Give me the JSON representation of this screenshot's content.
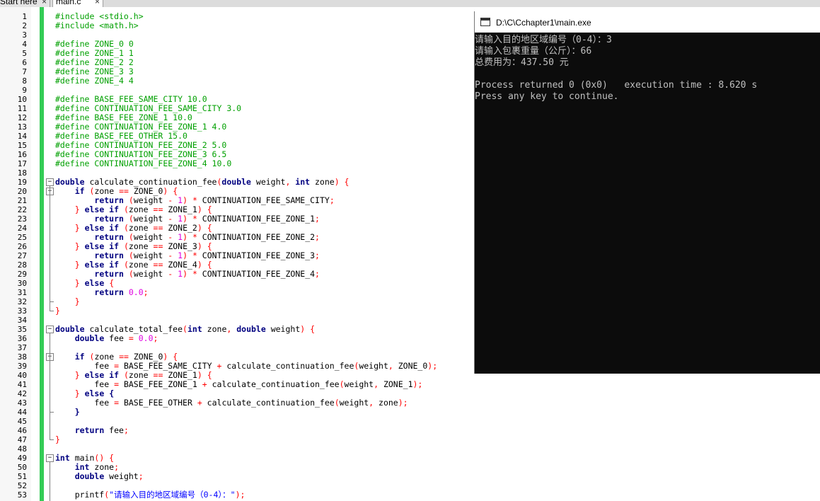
{
  "tabs": [
    {
      "label": "Start here",
      "close": "×"
    },
    {
      "label": "main.c",
      "close": "×"
    }
  ],
  "editor": {
    "lines": [
      {
        "n": "1",
        "t": [
          [
            "pp",
            "#include <stdio.h>"
          ]
        ]
      },
      {
        "n": "2",
        "t": [
          [
            "pp",
            "#include <math.h>"
          ]
        ]
      },
      {
        "n": "3",
        "t": []
      },
      {
        "n": "4",
        "t": [
          [
            "pp",
            "#define ZONE_0 0"
          ]
        ]
      },
      {
        "n": "5",
        "t": [
          [
            "pp",
            "#define ZONE_1 1"
          ]
        ]
      },
      {
        "n": "6",
        "t": [
          [
            "pp",
            "#define ZONE_2 2"
          ]
        ]
      },
      {
        "n": "7",
        "t": [
          [
            "pp",
            "#define ZONE_3 3"
          ]
        ]
      },
      {
        "n": "8",
        "t": [
          [
            "pp",
            "#define ZONE_4 4"
          ]
        ]
      },
      {
        "n": "9",
        "t": []
      },
      {
        "n": "10",
        "t": [
          [
            "pp",
            "#define BASE_FEE_SAME_CITY 10.0"
          ]
        ]
      },
      {
        "n": "11",
        "t": [
          [
            "pp",
            "#define CONTINUATION_FEE_SAME_CITY 3.0"
          ]
        ]
      },
      {
        "n": "12",
        "t": [
          [
            "pp",
            "#define BASE_FEE_ZONE_1 10.0"
          ]
        ]
      },
      {
        "n": "13",
        "t": [
          [
            "pp",
            "#define CONTINUATION_FEE_ZONE_1 4.0"
          ]
        ]
      },
      {
        "n": "14",
        "t": [
          [
            "pp",
            "#define BASE_FEE_OTHER 15.0"
          ]
        ]
      },
      {
        "n": "15",
        "t": [
          [
            "pp",
            "#define CONTINUATION_FEE_ZONE_2 5.0"
          ]
        ]
      },
      {
        "n": "16",
        "t": [
          [
            "pp",
            "#define CONTINUATION_FEE_ZONE_3 6.5"
          ]
        ]
      },
      {
        "n": "17",
        "t": [
          [
            "pp",
            "#define CONTINUATION_FEE_ZONE_4 10.0"
          ]
        ]
      },
      {
        "n": "18",
        "t": []
      },
      {
        "n": "19",
        "fold": "-",
        "t": [
          [
            "kw",
            "double"
          ],
          [
            "id",
            " calculate_continuation_fee"
          ],
          [
            "op",
            "("
          ],
          [
            "kw",
            "double"
          ],
          [
            "id",
            " weight"
          ],
          [
            "op",
            ", "
          ],
          [
            "kw",
            "int"
          ],
          [
            "id",
            " zone"
          ],
          [
            "op",
            ") {"
          ]
        ]
      },
      {
        "n": "20",
        "fold": "-",
        "t": [
          [
            "id",
            "    "
          ],
          [
            "kw",
            "if"
          ],
          [
            "id",
            " "
          ],
          [
            "op",
            "("
          ],
          [
            "id",
            "zone "
          ],
          [
            "op",
            "=="
          ],
          [
            "id",
            " ZONE_0"
          ],
          [
            "op",
            ") {"
          ]
        ]
      },
      {
        "n": "21",
        "t": [
          [
            "id",
            "        "
          ],
          [
            "kw",
            "return"
          ],
          [
            "id",
            " "
          ],
          [
            "op",
            "("
          ],
          [
            "id",
            "weight "
          ],
          [
            "op",
            "-"
          ],
          [
            "id",
            " "
          ],
          [
            "num",
            "1"
          ],
          [
            "op",
            ") *"
          ],
          [
            "id",
            " CONTINUATION_FEE_SAME_CITY"
          ],
          [
            "op",
            ";"
          ]
        ]
      },
      {
        "n": "22",
        "t": [
          [
            "id",
            "    "
          ],
          [
            "op",
            "} "
          ],
          [
            "kw",
            "else if"
          ],
          [
            "id",
            " "
          ],
          [
            "op",
            "("
          ],
          [
            "id",
            "zone "
          ],
          [
            "op",
            "=="
          ],
          [
            "id",
            " ZONE_1"
          ],
          [
            "op",
            ") {"
          ]
        ]
      },
      {
        "n": "23",
        "t": [
          [
            "id",
            "        "
          ],
          [
            "kw",
            "return"
          ],
          [
            "id",
            " "
          ],
          [
            "op",
            "("
          ],
          [
            "id",
            "weight "
          ],
          [
            "op",
            "-"
          ],
          [
            "id",
            " "
          ],
          [
            "num",
            "1"
          ],
          [
            "op",
            ") *"
          ],
          [
            "id",
            " CONTINUATION_FEE_ZONE_1"
          ],
          [
            "op",
            ";"
          ]
        ]
      },
      {
        "n": "24",
        "t": [
          [
            "id",
            "    "
          ],
          [
            "op",
            "} "
          ],
          [
            "kw",
            "else if"
          ],
          [
            "id",
            " "
          ],
          [
            "op",
            "("
          ],
          [
            "id",
            "zone "
          ],
          [
            "op",
            "=="
          ],
          [
            "id",
            " ZONE_2"
          ],
          [
            "op",
            ") {"
          ]
        ]
      },
      {
        "n": "25",
        "t": [
          [
            "id",
            "        "
          ],
          [
            "kw",
            "return"
          ],
          [
            "id",
            " "
          ],
          [
            "op",
            "("
          ],
          [
            "id",
            "weight "
          ],
          [
            "op",
            "-"
          ],
          [
            "id",
            " "
          ],
          [
            "num",
            "1"
          ],
          [
            "op",
            ") *"
          ],
          [
            "id",
            " CONTINUATION_FEE_ZONE_2"
          ],
          [
            "op",
            ";"
          ]
        ]
      },
      {
        "n": "26",
        "t": [
          [
            "id",
            "    "
          ],
          [
            "op",
            "} "
          ],
          [
            "kw",
            "else if"
          ],
          [
            "id",
            " "
          ],
          [
            "op",
            "("
          ],
          [
            "id",
            "zone "
          ],
          [
            "op",
            "=="
          ],
          [
            "id",
            " ZONE_3"
          ],
          [
            "op",
            ") {"
          ]
        ]
      },
      {
        "n": "27",
        "t": [
          [
            "id",
            "        "
          ],
          [
            "kw",
            "return"
          ],
          [
            "id",
            " "
          ],
          [
            "op",
            "("
          ],
          [
            "id",
            "weight "
          ],
          [
            "op",
            "-"
          ],
          [
            "id",
            " "
          ],
          [
            "num",
            "1"
          ],
          [
            "op",
            ") *"
          ],
          [
            "id",
            " CONTINUATION_FEE_ZONE_3"
          ],
          [
            "op",
            ";"
          ]
        ]
      },
      {
        "n": "28",
        "t": [
          [
            "id",
            "    "
          ],
          [
            "op",
            "} "
          ],
          [
            "kw",
            "else if"
          ],
          [
            "id",
            " "
          ],
          [
            "op",
            "("
          ],
          [
            "id",
            "zone "
          ],
          [
            "op",
            "=="
          ],
          [
            "id",
            " ZONE_4"
          ],
          [
            "op",
            ") {"
          ]
        ]
      },
      {
        "n": "29",
        "t": [
          [
            "id",
            "        "
          ],
          [
            "kw",
            "return"
          ],
          [
            "id",
            " "
          ],
          [
            "op",
            "("
          ],
          [
            "id",
            "weight "
          ],
          [
            "op",
            "-"
          ],
          [
            "id",
            " "
          ],
          [
            "num",
            "1"
          ],
          [
            "op",
            ") *"
          ],
          [
            "id",
            " CONTINUATION_FEE_ZONE_4"
          ],
          [
            "op",
            ";"
          ]
        ]
      },
      {
        "n": "30",
        "t": [
          [
            "id",
            "    "
          ],
          [
            "op",
            "} "
          ],
          [
            "kw",
            "else"
          ],
          [
            "op",
            " {"
          ]
        ]
      },
      {
        "n": "31",
        "t": [
          [
            "id",
            "        "
          ],
          [
            "kw",
            "return"
          ],
          [
            "id",
            " "
          ],
          [
            "num",
            "0.0"
          ],
          [
            "op",
            ";"
          ]
        ]
      },
      {
        "n": "32",
        "t": [
          [
            "id",
            "    "
          ],
          [
            "op",
            "}"
          ]
        ]
      },
      {
        "n": "33",
        "t": [
          [
            "op",
            "}"
          ]
        ]
      },
      {
        "n": "34",
        "t": []
      },
      {
        "n": "35",
        "fold": "-",
        "t": [
          [
            "kw",
            "double"
          ],
          [
            "id",
            " calculate_total_fee"
          ],
          [
            "op",
            "("
          ],
          [
            "kw",
            "int"
          ],
          [
            "id",
            " zone"
          ],
          [
            "op",
            ", "
          ],
          [
            "kw",
            "double"
          ],
          [
            "id",
            " weight"
          ],
          [
            "op",
            ") {"
          ]
        ]
      },
      {
        "n": "36",
        "t": [
          [
            "id",
            "    "
          ],
          [
            "kw",
            "double"
          ],
          [
            "id",
            " fee "
          ],
          [
            "op",
            "="
          ],
          [
            "id",
            " "
          ],
          [
            "num",
            "0.0"
          ],
          [
            "op",
            ";"
          ]
        ]
      },
      {
        "n": "37",
        "t": []
      },
      {
        "n": "38",
        "fold": "-",
        "t": [
          [
            "id",
            "    "
          ],
          [
            "kw",
            "if"
          ],
          [
            "id",
            " "
          ],
          [
            "op",
            "("
          ],
          [
            "id",
            "zone "
          ],
          [
            "op",
            "=="
          ],
          [
            "id",
            " ZONE_0"
          ],
          [
            "op",
            ") {"
          ]
        ]
      },
      {
        "n": "39",
        "t": [
          [
            "id",
            "        fee "
          ],
          [
            "op",
            "="
          ],
          [
            "id",
            " BASE_FEE_SAME_CITY "
          ],
          [
            "op",
            "+"
          ],
          [
            "id",
            " calculate_continuation_fee"
          ],
          [
            "op",
            "("
          ],
          [
            "id",
            "weight"
          ],
          [
            "op",
            ","
          ],
          [
            "id",
            " ZONE_0"
          ],
          [
            "op",
            ");"
          ]
        ]
      },
      {
        "n": "40",
        "t": [
          [
            "id",
            "    "
          ],
          [
            "op",
            "} "
          ],
          [
            "kw",
            "else if"
          ],
          [
            "id",
            " "
          ],
          [
            "op",
            "("
          ],
          [
            "id",
            "zone "
          ],
          [
            "op",
            "=="
          ],
          [
            "id",
            " ZONE_1"
          ],
          [
            "op",
            ") {"
          ]
        ]
      },
      {
        "n": "41",
        "t": [
          [
            "id",
            "        fee "
          ],
          [
            "op",
            "="
          ],
          [
            "id",
            " BASE_FEE_ZONE_1 "
          ],
          [
            "op",
            "+"
          ],
          [
            "id",
            " calculate_continuation_fee"
          ],
          [
            "op",
            "("
          ],
          [
            "id",
            "weight"
          ],
          [
            "op",
            ","
          ],
          [
            "id",
            " ZONE_1"
          ],
          [
            "op",
            ");"
          ]
        ]
      },
      {
        "n": "42",
        "t": [
          [
            "id",
            "    "
          ],
          [
            "op",
            "} "
          ],
          [
            "kw",
            "else"
          ],
          [
            "id",
            " "
          ],
          [
            "kw",
            "{"
          ]
        ]
      },
      {
        "n": "43",
        "t": [
          [
            "id",
            "        fee "
          ],
          [
            "op",
            "="
          ],
          [
            "id",
            " BASE_FEE_OTHER "
          ],
          [
            "op",
            "+"
          ],
          [
            "id",
            " calculate_continuation_fee"
          ],
          [
            "op",
            "("
          ],
          [
            "id",
            "weight"
          ],
          [
            "op",
            ","
          ],
          [
            "id",
            " zone"
          ],
          [
            "op",
            ");"
          ]
        ]
      },
      {
        "n": "44",
        "t": [
          [
            "id",
            "    "
          ],
          [
            "kw",
            "}"
          ]
        ]
      },
      {
        "n": "45",
        "t": []
      },
      {
        "n": "46",
        "t": [
          [
            "id",
            "    "
          ],
          [
            "kw",
            "return"
          ],
          [
            "id",
            " fee"
          ],
          [
            "op",
            ";"
          ]
        ]
      },
      {
        "n": "47",
        "t": [
          [
            "op",
            "}"
          ]
        ]
      },
      {
        "n": "48",
        "t": []
      },
      {
        "n": "49",
        "fold": "-",
        "t": [
          [
            "kw",
            "int"
          ],
          [
            "id",
            " main"
          ],
          [
            "op",
            "() {"
          ]
        ]
      },
      {
        "n": "50",
        "t": [
          [
            "id",
            "    "
          ],
          [
            "kw",
            "int"
          ],
          [
            "id",
            " zone"
          ],
          [
            "op",
            ";"
          ]
        ]
      },
      {
        "n": "51",
        "t": [
          [
            "id",
            "    "
          ],
          [
            "kw",
            "double"
          ],
          [
            "id",
            " weight"
          ],
          [
            "op",
            ";"
          ]
        ]
      },
      {
        "n": "52",
        "t": []
      },
      {
        "n": "53",
        "t": [
          [
            "id",
            "    printf"
          ],
          [
            "op",
            "("
          ],
          [
            "str",
            "\"请输入目的地区域编号（0-4）：\""
          ],
          [
            "op",
            ");"
          ]
        ]
      }
    ]
  },
  "console": {
    "title": "D:\\C\\Cchapter1\\main.exe",
    "lines": [
      "请输入目的地区域编号（0-4）：3",
      "请输入包裹重量（公斤）：66",
      "总费用为：437.50 元",
      "",
      "Process returned 0 (0x0)   execution time : 8.620 s",
      "Press any key to continue."
    ]
  }
}
